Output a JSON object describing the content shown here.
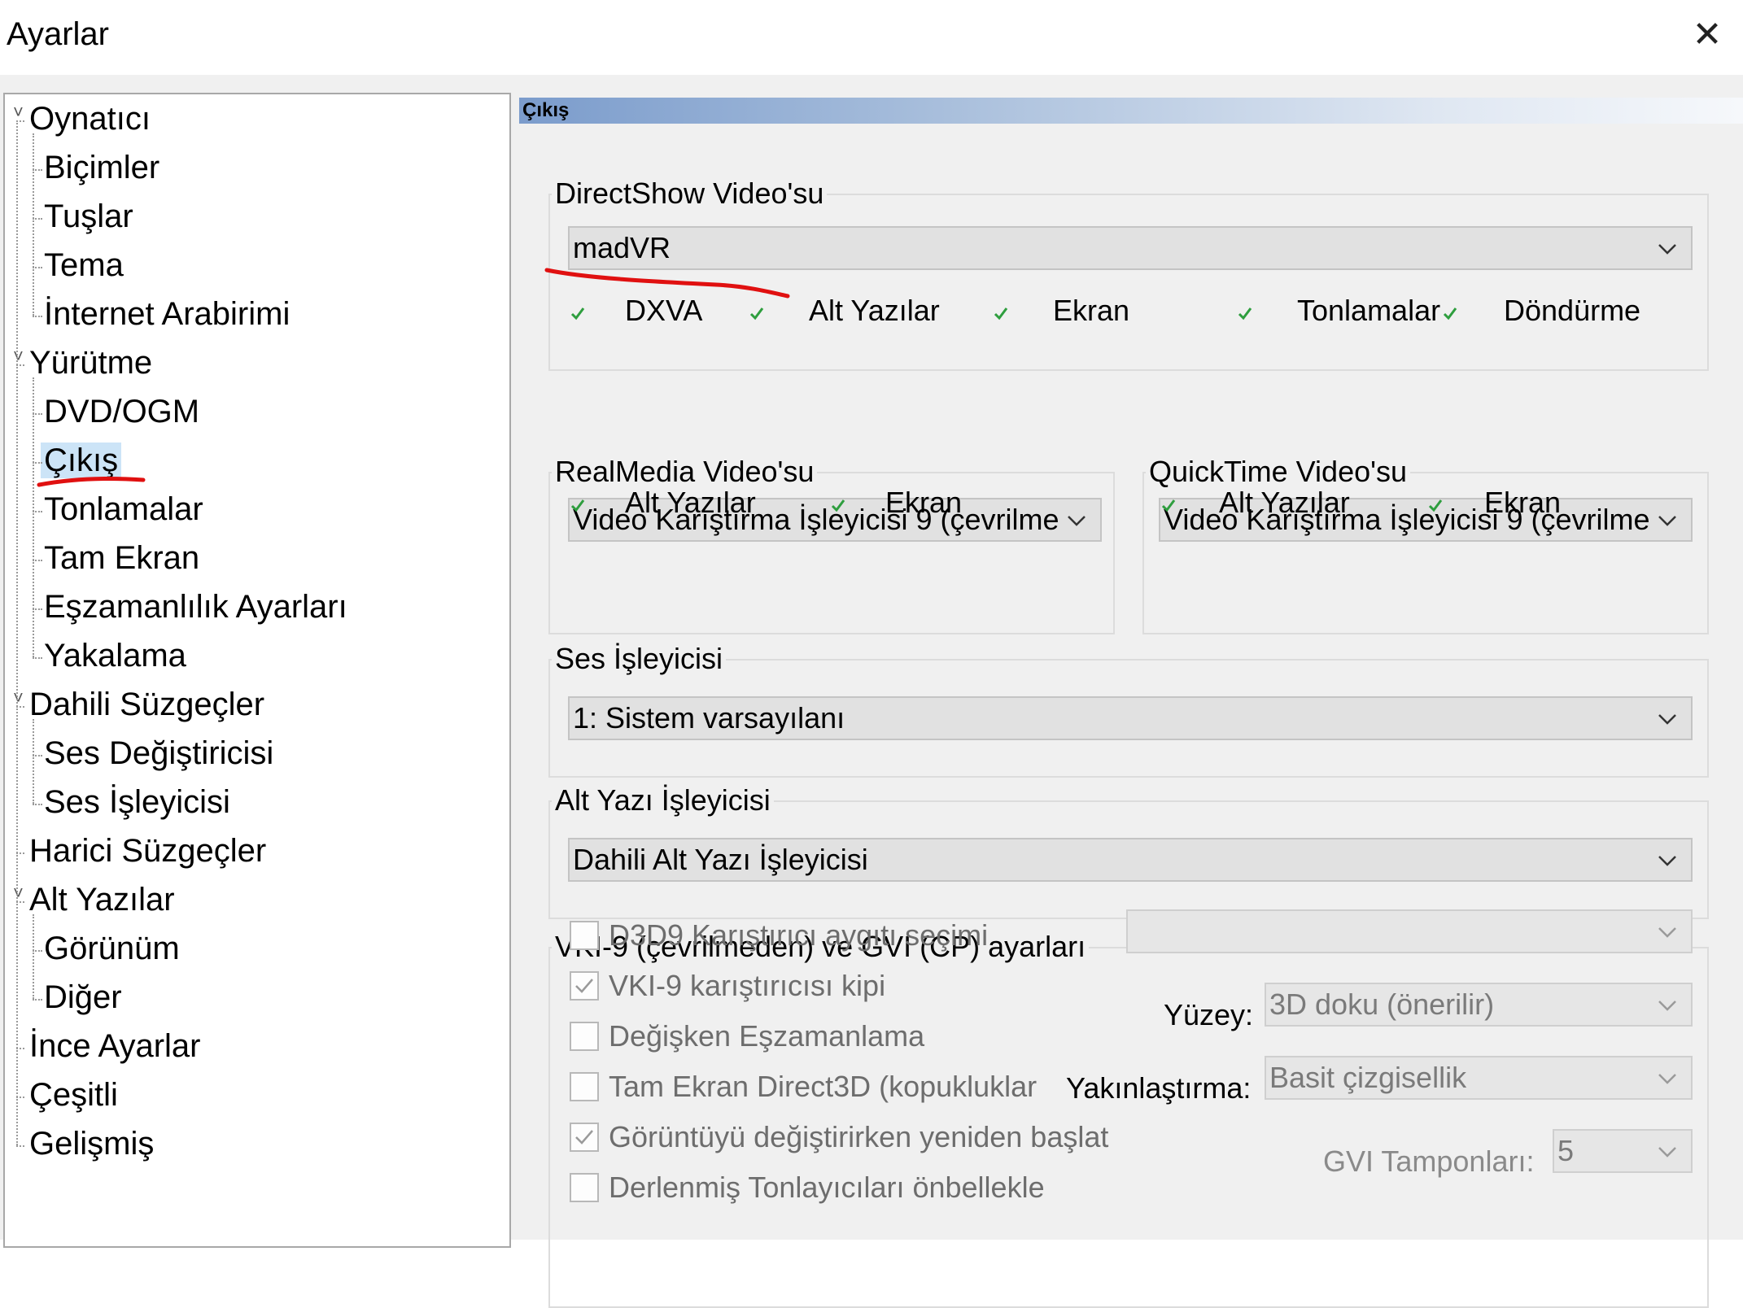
{
  "window": {
    "title": "Ayarlar",
    "close_glyph": "✕"
  },
  "tree": {
    "items": [
      {
        "label": "Oynatıcı",
        "expander": "˅"
      },
      {
        "label": "Biçimler"
      },
      {
        "label": "Tuşlar"
      },
      {
        "label": "Tema"
      },
      {
        "label": "İnternet Arabirimi"
      },
      {
        "label": "Yürütme",
        "expander": "˅"
      },
      {
        "label": "DVD/OGM"
      },
      {
        "label": "Çıkış",
        "selected": true
      },
      {
        "label": "Tonlamalar"
      },
      {
        "label": "Tam Ekran"
      },
      {
        "label": "Eşzamanlılık Ayarları"
      },
      {
        "label": "Yakalama"
      },
      {
        "label": "Dahili Süzgeçler",
        "expander": "˅"
      },
      {
        "label": "Ses Değiştiricisi"
      },
      {
        "label": "Ses İşleyicisi"
      },
      {
        "label": "Harici Süzgeçler"
      },
      {
        "label": "Alt Yazılar",
        "expander": "˅"
      },
      {
        "label": "Görünüm"
      },
      {
        "label": "Diğer"
      },
      {
        "label": "İnce Ayarlar"
      },
      {
        "label": "Çeşitli"
      },
      {
        "label": "Gelişmiş"
      }
    ]
  },
  "panel": {
    "header": "Çıkış",
    "directshow": {
      "title": "DirectShow Video'su",
      "selected": "madVR",
      "features": [
        "DXVA",
        "Alt Yazılar",
        "Ekran",
        "Tonlamalar",
        "Döndürme"
      ]
    },
    "realmedia": {
      "title": "RealMedia Video'su",
      "selected": "Video Karıştırma İşleyicisi 9 (çevrilme",
      "features": [
        "Alt Yazılar",
        "Ekran"
      ]
    },
    "quicktime": {
      "title": "QuickTime Video'su",
      "selected": "Video Karıştırma İşleyicisi 9 (çevrilme",
      "features": [
        "Alt Yazılar",
        "Ekran"
      ]
    },
    "audio": {
      "title": "Ses İşleyicisi",
      "selected": "1: Sistem varsayılanı"
    },
    "subtitle": {
      "title": "Alt Yazı İşleyicisi",
      "selected": "Dahili Alt Yazı İşleyicisi"
    },
    "vmr": {
      "title": "VKI-9 (çevrilmeden) ve GVI (CP) ayarları",
      "options": [
        {
          "label": "D3D9 Karıştırıcı aygıtı seçimi",
          "checked": false
        },
        {
          "label": "VKI-9 karıştırıcısı kipi",
          "checked": true
        },
        {
          "label": "Değişken Eşzamanlama",
          "checked": false
        },
        {
          "label": "Tam Ekran Direct3D (kopukluklar",
          "checked": false
        },
        {
          "label": "Görüntüyü değiştirirken yeniden başlat",
          "checked": true
        },
        {
          "label": "Derlenmiş Tonlayıcıları önbellekle",
          "checked": false
        }
      ],
      "device_select": "",
      "surface_label": "Yüzey:",
      "surface_value": "3D doku (önerilir)",
      "resize_label": "Yakınlaştırma:",
      "resize_value": "Basit çizgisellik",
      "buffers_label": "GVI Tamponları:",
      "buffers_value": "5"
    }
  },
  "colors": {
    "annotation_red": "#e01010",
    "selection": "#cce4f7",
    "checkmark_green": "#2e9e3e"
  },
  "icons": {
    "close": "close-icon",
    "dropdown": "chevron-down-icon",
    "check": "checkmark-icon"
  }
}
